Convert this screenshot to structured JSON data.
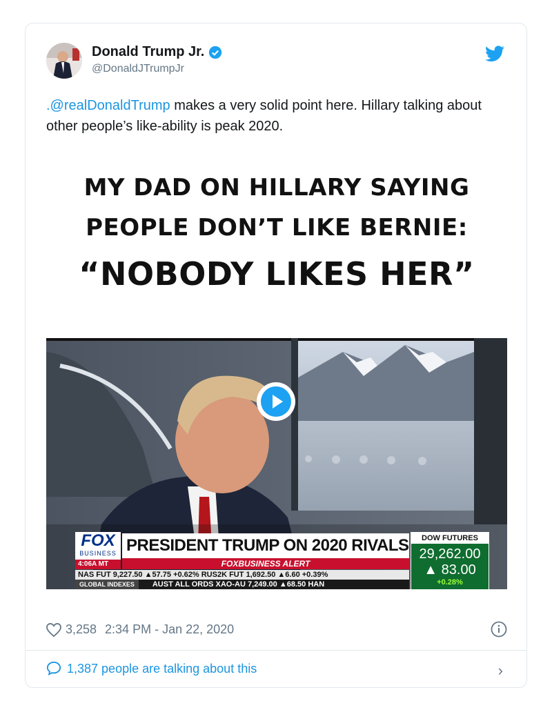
{
  "tweet": {
    "display_name": "Donald Trump Jr.",
    "handle": "@DonaldJTrumpJr",
    "text_mention": ".@realDonaldTrump",
    "text_body": " makes a very solid point here. Hillary talking about other people’s like-ability is peak 2020.",
    "likes": "3,258",
    "timestamp": "2:34 PM - Jan 22, 2020",
    "talking": "1,387 people are talking about this"
  },
  "media": {
    "headline_1": "MY DAD ON HILLARY SAYING",
    "headline_2": "PEOPLE DON’T LIKE BERNIE:",
    "headline_3": "“NOBODY LIKES HER”"
  },
  "ticker": {
    "logo": "FOX",
    "logo_sub": "BUSINESS",
    "time": "4:06A MT",
    "chyron": "PRESIDENT TRUMP ON 2020 RIVALS",
    "alert": "FOXBUSINESS ALERT",
    "dow_label": "DOW FUTURES",
    "dow_value": "29,262.00",
    "dow_change": "▲ 83.00",
    "dow_pct": "+0.28%",
    "row1": "NAS FUT  9,227.50 ▲57.75 +0.62%  RUS2K FUT  1,692.50 ▲6.60 +0.39%",
    "row2_left": "GLOBAL INDEXES",
    "row2": "AUST ALL ORDS  XAO-AU  7,249.00 ▲68.50  HAN"
  },
  "icons": {
    "verified": "verified-badge-icon",
    "bird": "twitter-bird-icon",
    "heart": "heart-icon",
    "info": "info-icon",
    "comment": "comment-icon",
    "chevron": "chevron-right-icon",
    "play": "play-icon"
  },
  "colors": {
    "link": "#1b95e0",
    "twitter_blue": "#1da1f2",
    "muted": "#657786",
    "fox_red": "#c8102e"
  }
}
